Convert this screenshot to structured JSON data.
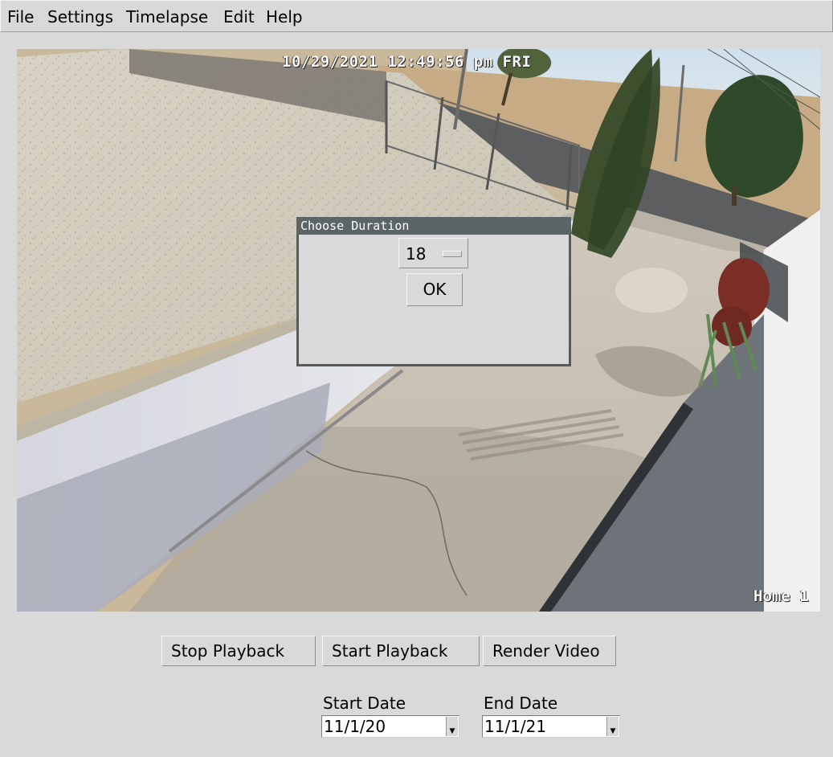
{
  "menubar": {
    "items": [
      "File",
      "Settings",
      "Timelapse",
      "Edit",
      "Help"
    ]
  },
  "camera": {
    "timestamp": "10/29/2021 12:49:56 pm FRI",
    "channel": "Home 1"
  },
  "dialog": {
    "title": "Choose Duration",
    "duration_value": "18",
    "ok_label": "OK"
  },
  "controls": {
    "stop_label": "Stop Playback",
    "start_label": "Start Playback",
    "render_label": "Render Video"
  },
  "dates": {
    "start_label": "Start Date",
    "start_value": "11/1/20",
    "end_label": "End Date",
    "end_value": "11/1/21"
  },
  "icons": {
    "option_indicator": "option-menu-indicator-icon",
    "dropdown": "dropdown-arrow-icon"
  }
}
